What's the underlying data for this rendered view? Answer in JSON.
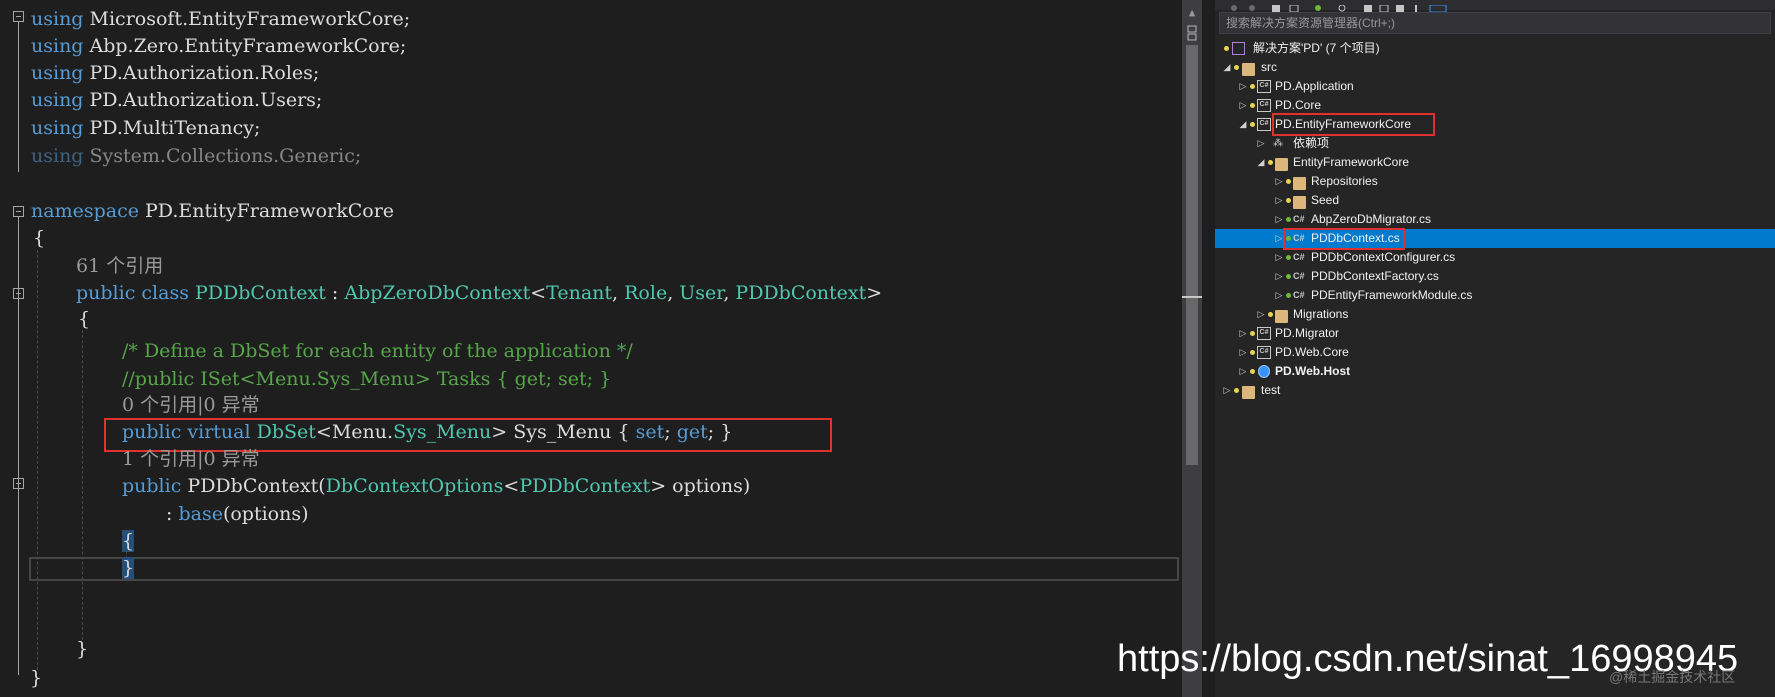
{
  "editor": {
    "using_lines": [
      {
        "kw": "using",
        "ns": "Microsoft.EntityFrameworkCore;"
      },
      {
        "kw": "using",
        "ns": "Abp.Zero.EntityFrameworkCore;"
      },
      {
        "kw": "using",
        "ns": "PD.Authorization.Roles;"
      },
      {
        "kw": "using",
        "ns": "PD.Authorization.Users;"
      },
      {
        "kw": "using",
        "ns": "PD.MultiTenancy;"
      },
      {
        "kw": "using",
        "ns": "System.Collections.Generic;"
      }
    ],
    "namespace_kw": "namespace",
    "namespace_name": "PD.EntityFrameworkCore",
    "open_brace": "{",
    "close_brace": "}",
    "class_lens": "61 个引用",
    "class_decl": {
      "kw": "public class",
      "name": "PDDbContext",
      "colon": ":",
      "base": "AbpZeroDbContext",
      "lt": "<",
      "args": [
        "Tenant",
        "Role",
        "User",
        "PDDbContext"
      ],
      "gt": ">"
    },
    "comment1": "/* Define a DbSet for each entity of the application */",
    "comment2": "//public ISet<Menu.Sys_Menu> Tasks { get; set; }",
    "prop_lens": "0 个引用|0 异常",
    "prop_decl": {
      "kw": "public virtual",
      "type": "DbSet",
      "generic_open": "<Menu.",
      "generic_type": "Sys_Menu",
      "generic_close": ">",
      "name": "Sys_Menu",
      "open": "{",
      "set": "set",
      "get": "get",
      "close": "}"
    },
    "ctor_lens": "1 个引用|0 异常",
    "ctor_decl": {
      "kw": "public",
      "name": "PDDbContext",
      "paren": "(",
      "param_type": "DbContextOptions",
      "lt": "<",
      "param_arg": "PDDbContext",
      "gt": ">",
      "param_name": "options)"
    },
    "base_call": {
      "colon": ":",
      "kw": "base",
      "args": "(options)"
    }
  },
  "explorer": {
    "search_placeholder": "搜索解决方案资源管理器(Ctrl+;)",
    "items": [
      {
        "label": "解决方案'PD' (7 个项目)",
        "icon": "solution-icon"
      },
      {
        "label": "src",
        "icon": "folder-icon"
      },
      {
        "label": "PD.Application",
        "icon": "csharp-project-icon"
      },
      {
        "label": "PD.Core",
        "icon": "csharp-project-icon"
      },
      {
        "label": "PD.EntityFrameworkCore",
        "icon": "csharp-project-icon"
      },
      {
        "label": "依赖项",
        "icon": "dependencies-icon"
      },
      {
        "label": "EntityFrameworkCore",
        "icon": "folder-icon"
      },
      {
        "label": "Repositories",
        "icon": "folder-icon"
      },
      {
        "label": "Seed",
        "icon": "folder-icon"
      },
      {
        "label": "AbpZeroDbMigrator.cs",
        "icon": "csharp-file-icon"
      },
      {
        "label": "PDDbContext.cs",
        "icon": "csharp-file-icon"
      },
      {
        "label": "PDDbContextConfigurer.cs",
        "icon": "csharp-file-icon"
      },
      {
        "label": "PDDbContextFactory.cs",
        "icon": "csharp-file-icon"
      },
      {
        "label": "PDEntityFrameworkModule.cs",
        "icon": "csharp-file-icon"
      },
      {
        "label": "Migrations",
        "icon": "folder-icon"
      },
      {
        "label": "PD.Migrator",
        "icon": "csharp-project-icon"
      },
      {
        "label": "PD.Web.Core",
        "icon": "csharp-project-icon"
      },
      {
        "label": "PD.Web.Host",
        "icon": "web-project-icon"
      },
      {
        "label": "test",
        "icon": "folder-icon"
      }
    ],
    "csharp_glyph": "C#"
  },
  "watermark": {
    "url": "https://blog.csdn.net/sinat_16998945",
    "credit": "@稀土掘金技术社区"
  },
  "colors": {
    "highlight_box": "#e0312f",
    "selection": "#007acc",
    "keyword": "#569cd6",
    "type": "#4ec9b0",
    "comment": "#57a64a"
  }
}
